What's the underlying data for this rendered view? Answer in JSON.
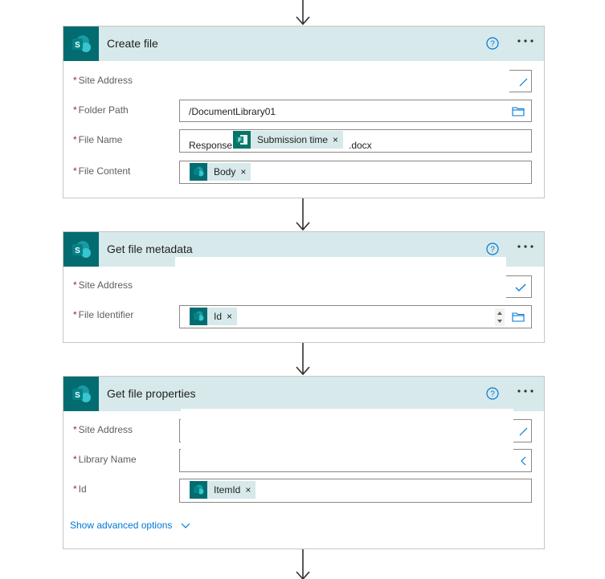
{
  "cards": [
    {
      "title": "Create file",
      "fields": [
        {
          "label": "Site Address",
          "required": "*"
        },
        {
          "label": "Folder Path",
          "required": "*",
          "value": "/DocumentLibrary01"
        },
        {
          "label": "File Name",
          "required": "*",
          "prefix": "Response",
          "token": "Submission time",
          "suffix": ".docx"
        },
        {
          "label": "File Content",
          "required": "*",
          "token": "Body"
        }
      ]
    },
    {
      "title": "Get file metadata",
      "fields": [
        {
          "label": "Site Address",
          "required": "*"
        },
        {
          "label": "File Identifier",
          "required": "*",
          "token": "Id"
        }
      ]
    },
    {
      "title": "Get file properties",
      "fields": [
        {
          "label": "Site Address",
          "required": "*"
        },
        {
          "label": "Library Name",
          "required": "*"
        },
        {
          "label": "Id",
          "required": "*",
          "token": "ItemId"
        }
      ],
      "advanced_link": "Show advanced options"
    }
  ],
  "icons": {
    "connector": "sharepoint-icon",
    "forms": "forms-icon",
    "help": "help-icon",
    "more": "more-options-icon",
    "folder": "folder-icon",
    "arrow": "arrow-down-icon"
  },
  "colors": {
    "sharepoint": "#036c70",
    "header_bg": "#d7e9ea",
    "required": "#a4262c",
    "link": "#0078d4"
  }
}
